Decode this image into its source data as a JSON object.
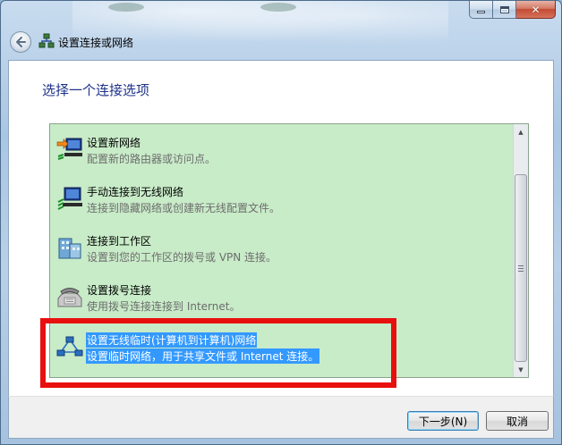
{
  "window": {
    "title": "设置连接或网络",
    "caption_buttons": {
      "minimize": "minimize",
      "maximize": "maximize",
      "close": "✕"
    }
  },
  "page": {
    "heading": "选择一个连接选项"
  },
  "options": [
    {
      "title": "设置新网络",
      "description": "配置新的路由器或访问点。",
      "icon": "new-network-icon",
      "selected": false
    },
    {
      "title": "手动连接到无线网络",
      "description": "连接到隐藏网络或创建新无线配置文件。",
      "icon": "wireless-connect-icon",
      "selected": false
    },
    {
      "title": "连接到工作区",
      "description": "设置到您的工作区的拨号或 VPN 连接。",
      "icon": "workplace-icon",
      "selected": false
    },
    {
      "title": "设置拨号连接",
      "description": "使用拨号连接连接到 Internet。",
      "icon": "dialup-phone-icon",
      "selected": false
    },
    {
      "title": "设置无线临时(计算机到计算机)网络",
      "description": "设置临时网络，用于共享文件或 Internet 连接。",
      "icon": "adhoc-network-icon",
      "selected": true
    }
  ],
  "footer": {
    "next_label": "下一步(N)",
    "cancel_label": "取消"
  },
  "colors": {
    "list_background": "#c8ebc8",
    "selection": "#3399ff",
    "highlight_box": "#e8100f",
    "heading": "#1e3287"
  }
}
